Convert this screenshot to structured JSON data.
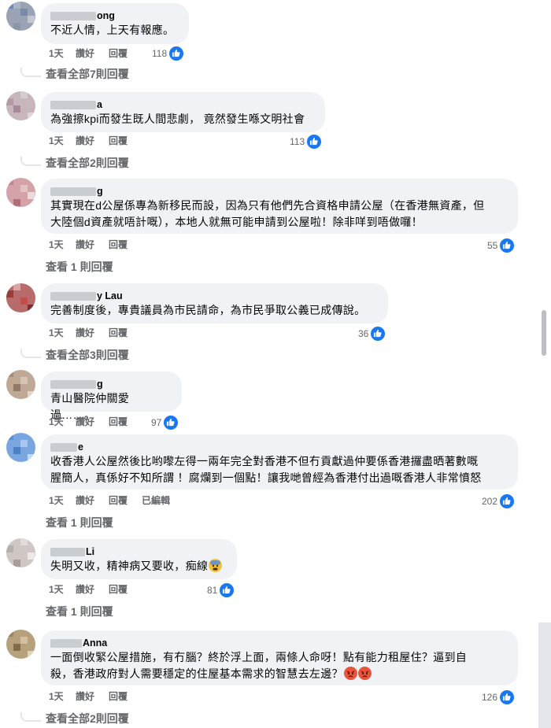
{
  "comments": [
    {
      "name": "ong",
      "text": "不近人情，上天有報應。",
      "time": "1天",
      "like": "讚好",
      "reply": "回覆",
      "edited": "",
      "reactions": "118",
      "view_replies": "查看全部7則回覆"
    },
    {
      "name": "a",
      "text": "為強擦kpi而發生既人間悲劇， 竟然發生喺文明社會",
      "time": "1天",
      "like": "讚好",
      "reply": "回覆",
      "edited": "",
      "reactions": "113",
      "view_replies": "查看全部2則回覆"
    },
    {
      "name": "g",
      "text": "其實現在d公屋係專為新移民而設，因為只有他們先合資格申請公屋（在香港無資產，但\n大陸個d資產就唔計嘅），本地人就無可能申請到公屋啦！除非咩到唔做囉！",
      "time": "1天",
      "like": "讚好",
      "reply": "回覆",
      "edited": "",
      "reactions": "55",
      "view_replies": "查看 1 則回覆"
    },
    {
      "name": "y Lau",
      "text": "完善制度後，專貴議員為市民請命，為市民爭取公義已成傳說。",
      "time": "1天",
      "like": "讚好",
      "reply": "回覆",
      "edited": "",
      "reactions": "36",
      "view_replies": "查看全部3則回覆"
    },
    {
      "name": "g",
      "text": "青山醫院仲關愛過……。",
      "time": "1天",
      "like": "讚好",
      "reply": "回覆",
      "edited": "",
      "reactions": "97",
      "view_replies": ""
    },
    {
      "name": "e",
      "text": "收香港人公屋然後比哟嚟左得一兩年完全對香港不但冇貢獻過仲要係香港攞盡晒著數嘅\n腥簡人，真係好不知所謂 ！腐爛到一個點！讓我哋曾經為香港付出過嘅香港人非常憤怒",
      "time": "1天",
      "like": "讚好",
      "reply": "回覆",
      "edited": "已編輯",
      "reactions": "202",
      "view_replies": "查看 1 則回覆"
    },
    {
      "name": "Li",
      "text": "失明又收，精神病又要收，痴線",
      "time": "1天",
      "like": "讚好",
      "reply": "回覆",
      "edited": "",
      "reactions": "81",
      "view_replies": "查看 1 則回覆"
    },
    {
      "name": "Anna",
      "text": "一面倒收緊公屋措施，有冇腦？終於浮上面，兩條人命呀！點有能力租屋住？逼到自\n殺，香港政府對人需要穩定的住屋基本需求的智慧去左邊？",
      "time": "1天",
      "like": "讚好",
      "reply": "回覆",
      "edited": "",
      "reactions": "126",
      "view_replies": "查看全部2則回覆"
    }
  ],
  "icons": {
    "like": "thumbs-up-icon",
    "emoji_fearful": "anxious-face-icon",
    "emoji_angry": "angry-face-icon"
  },
  "colors": {
    "bubble": "#f0f2f5",
    "like_blue": "#1877f2",
    "meta_gray": "#65676b"
  }
}
